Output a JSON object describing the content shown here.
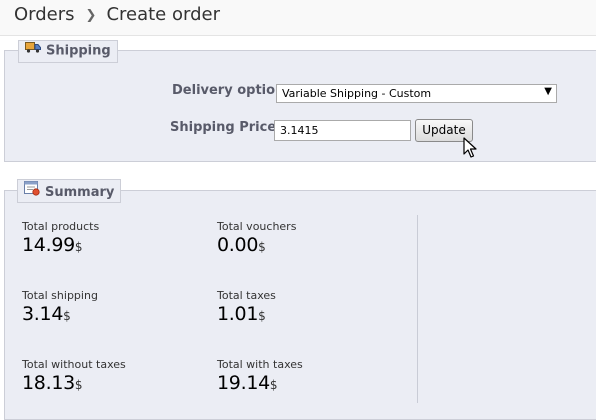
{
  "breadcrumb": {
    "parent": "Orders",
    "current": "Create order"
  },
  "shipping": {
    "legend": "Shipping",
    "delivery_label": "Delivery option",
    "delivery_selected": "Variable Shipping - Custom",
    "price_label": "Shipping Price:",
    "price_value": "3.1415",
    "update_label": "Update"
  },
  "summary": {
    "legend": "Summary",
    "currency": "$",
    "total_products": {
      "label": "Total products",
      "value": "14.99"
    },
    "total_vouchers": {
      "label": "Total vouchers",
      "value": "0.00"
    },
    "total_shipping": {
      "label": "Total shipping",
      "value": "3.14"
    },
    "total_taxes": {
      "label": "Total taxes",
      "value": "1.01"
    },
    "total_without_taxes": {
      "label": "Total without taxes",
      "value": "18.13"
    },
    "total_with_taxes": {
      "label": "Total with taxes",
      "value": "19.14"
    }
  },
  "colors": {
    "panel_bg": "#ebedf4",
    "panel_border": "#ccced7",
    "legend_text": "#585a69"
  },
  "icons": [
    "chevron-right-icon",
    "truck-icon",
    "summary-icon",
    "dropdown-arrow-icon",
    "mouse-cursor-icon"
  ]
}
